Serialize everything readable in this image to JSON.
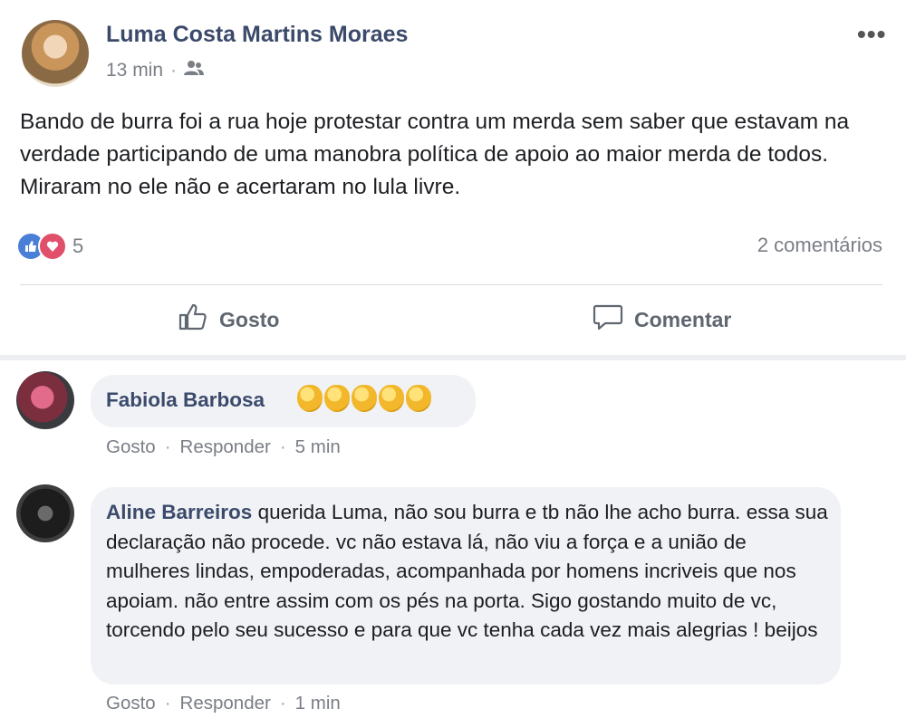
{
  "post": {
    "author": "Luma Costa Martins Moraes",
    "time": "13 min",
    "separator": "·",
    "audience_icon": "friends-icon",
    "more_label": "•••",
    "text": "Bando de burra foi a rua hoje protestar contra um merda sem saber que estavam na verdade participando de uma manobra política de apoio ao maior merda de todos. Miraram no ele não e acertaram no lula livre.",
    "reactions": {
      "icons": [
        "like-icon",
        "love-icon"
      ],
      "count": "5"
    },
    "comments_count": "2 comentários",
    "actions": {
      "like": "Gosto",
      "comment": "Comentar"
    }
  },
  "comments": [
    {
      "author": "Fabiola Barbosa",
      "emoji": "👏👏👏👏👏",
      "like": "Gosto",
      "reply": "Responder",
      "time": "5 min"
    },
    {
      "author": "Aline Barreiros",
      "text": "querida Luma, não sou burra e tb não lhe acho burra. essa sua declaração não procede. vc não estava lá, não viu a força e a união de mulheres lindas, empoderadas, acompanhada por homens incriveis que nos apoiam. não entre assim com os pés na porta. Sigo gostando muito de vc, torcendo pelo seu sucesso e para que vc tenha cada vez mais alegrias ! beijos",
      "like": "Gosto",
      "reply": "Responder",
      "time": "1 min"
    }
  ],
  "colors": {
    "name": "#3b4a6b",
    "muted": "#7a7e85",
    "like_blue": "#4a7fd8",
    "love_red": "#e0506a",
    "bubble": "#f0f2f5"
  }
}
